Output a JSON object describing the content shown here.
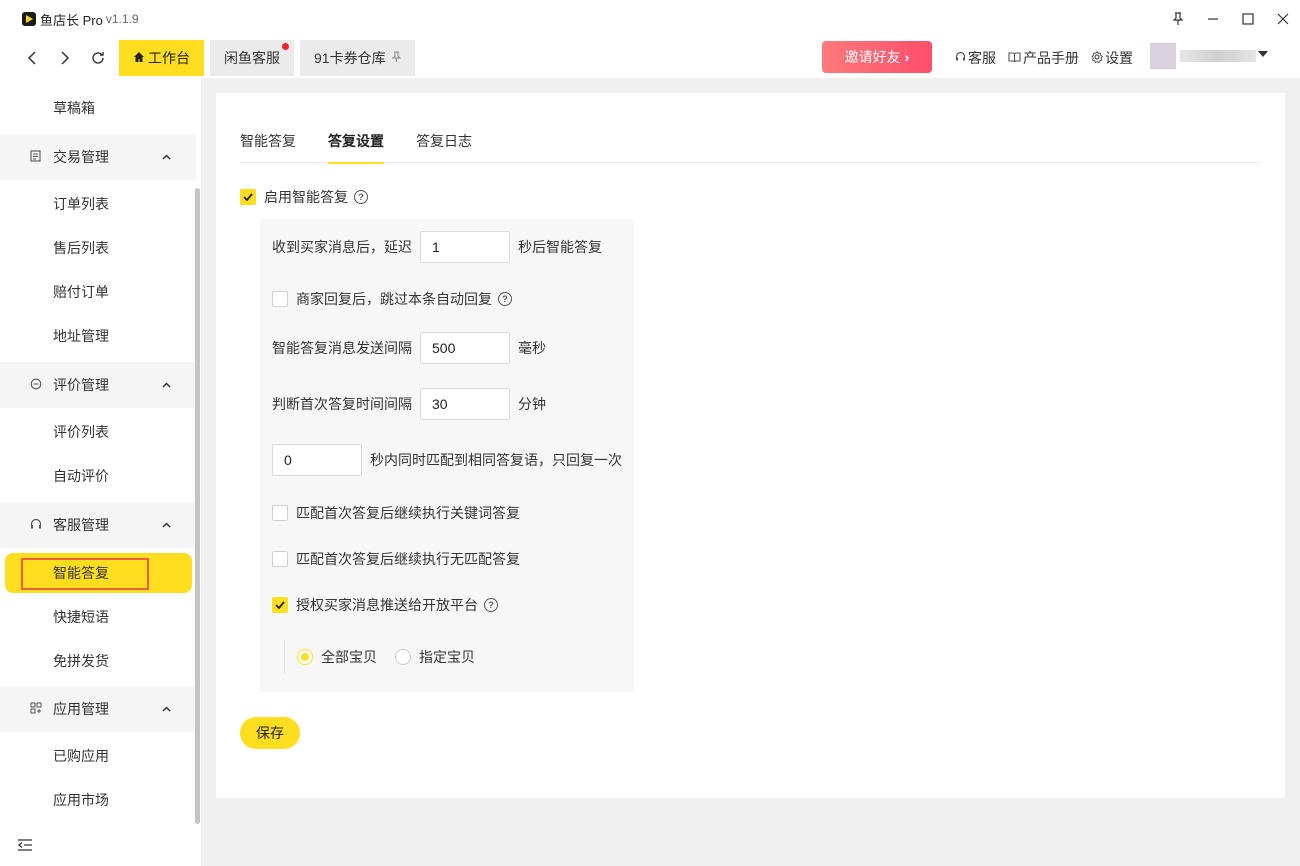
{
  "app": {
    "title": "鱼店长 Pro",
    "version": "v1.1.9"
  },
  "window_controls": {
    "pin": "⚲",
    "minimize": "—",
    "maximize": "☐",
    "close": "✕"
  },
  "nav": {
    "back": "‹",
    "forward": "›",
    "refresh": "↻",
    "tabs": [
      {
        "label": "工作台",
        "active": true
      },
      {
        "label": "闲鱼客服",
        "badge": true
      },
      {
        "label": "91卡券仓库",
        "pinned": true
      }
    ],
    "invite_label": "邀请好友",
    "links": [
      {
        "icon": "headset-icon",
        "label": "客服"
      },
      {
        "icon": "book-icon",
        "label": "产品手册"
      },
      {
        "icon": "gear-icon",
        "label": "设置"
      }
    ]
  },
  "sidebar": {
    "items": [
      {
        "label": "草稿箱",
        "type": "child"
      },
      {
        "label": "交易管理",
        "type": "group",
        "icon": "document-icon"
      },
      {
        "label": "订单列表",
        "type": "child"
      },
      {
        "label": "售后列表",
        "type": "child"
      },
      {
        "label": "赔付订单",
        "type": "child"
      },
      {
        "label": "地址管理",
        "type": "child"
      },
      {
        "label": "评价管理",
        "type": "group",
        "icon": "comment-icon"
      },
      {
        "label": "评价列表",
        "type": "child"
      },
      {
        "label": "自动评价",
        "type": "child"
      },
      {
        "label": "客服管理",
        "type": "group",
        "icon": "headset-icon"
      },
      {
        "label": "智能答复",
        "type": "child",
        "active": true
      },
      {
        "label": "快捷短语",
        "type": "child"
      },
      {
        "label": "免拼发货",
        "type": "child"
      },
      {
        "label": "应用管理",
        "type": "group",
        "icon": "apps-icon"
      },
      {
        "label": "已购应用",
        "type": "child"
      },
      {
        "label": "应用市场",
        "type": "child"
      }
    ]
  },
  "main": {
    "tabs": [
      {
        "label": "智能答复"
      },
      {
        "label": "答复设置",
        "active": true
      },
      {
        "label": "答复日志"
      }
    ],
    "enable": {
      "label": "启用智能答复",
      "checked": true
    },
    "delay": {
      "prefix": "收到买家消息后，延迟",
      "value": "1",
      "suffix": "秒后智能答复"
    },
    "skip_after_merchant": {
      "label": "商家回复后，跳过本条自动回复",
      "checked": false
    },
    "send_interval": {
      "prefix": "智能答复消息发送间隔",
      "value": "500",
      "suffix": "毫秒"
    },
    "first_interval": {
      "prefix": "判断首次答复时间间隔",
      "value": "30",
      "suffix": "分钟"
    },
    "dedupe": {
      "value": "0",
      "suffix": "秒内同时匹配到相同答复语，只回复一次"
    },
    "continue_keyword": {
      "label": "匹配首次答复后继续执行关键词答复",
      "checked": false
    },
    "continue_nomatch": {
      "label": "匹配首次答复后继续执行无匹配答复",
      "checked": false
    },
    "authorize_push": {
      "label": "授权买家消息推送给开放平台",
      "checked": true
    },
    "scope": {
      "options": [
        "全部宝贝",
        "指定宝贝"
      ],
      "selected": "全部宝贝"
    },
    "save_label": "保存"
  }
}
